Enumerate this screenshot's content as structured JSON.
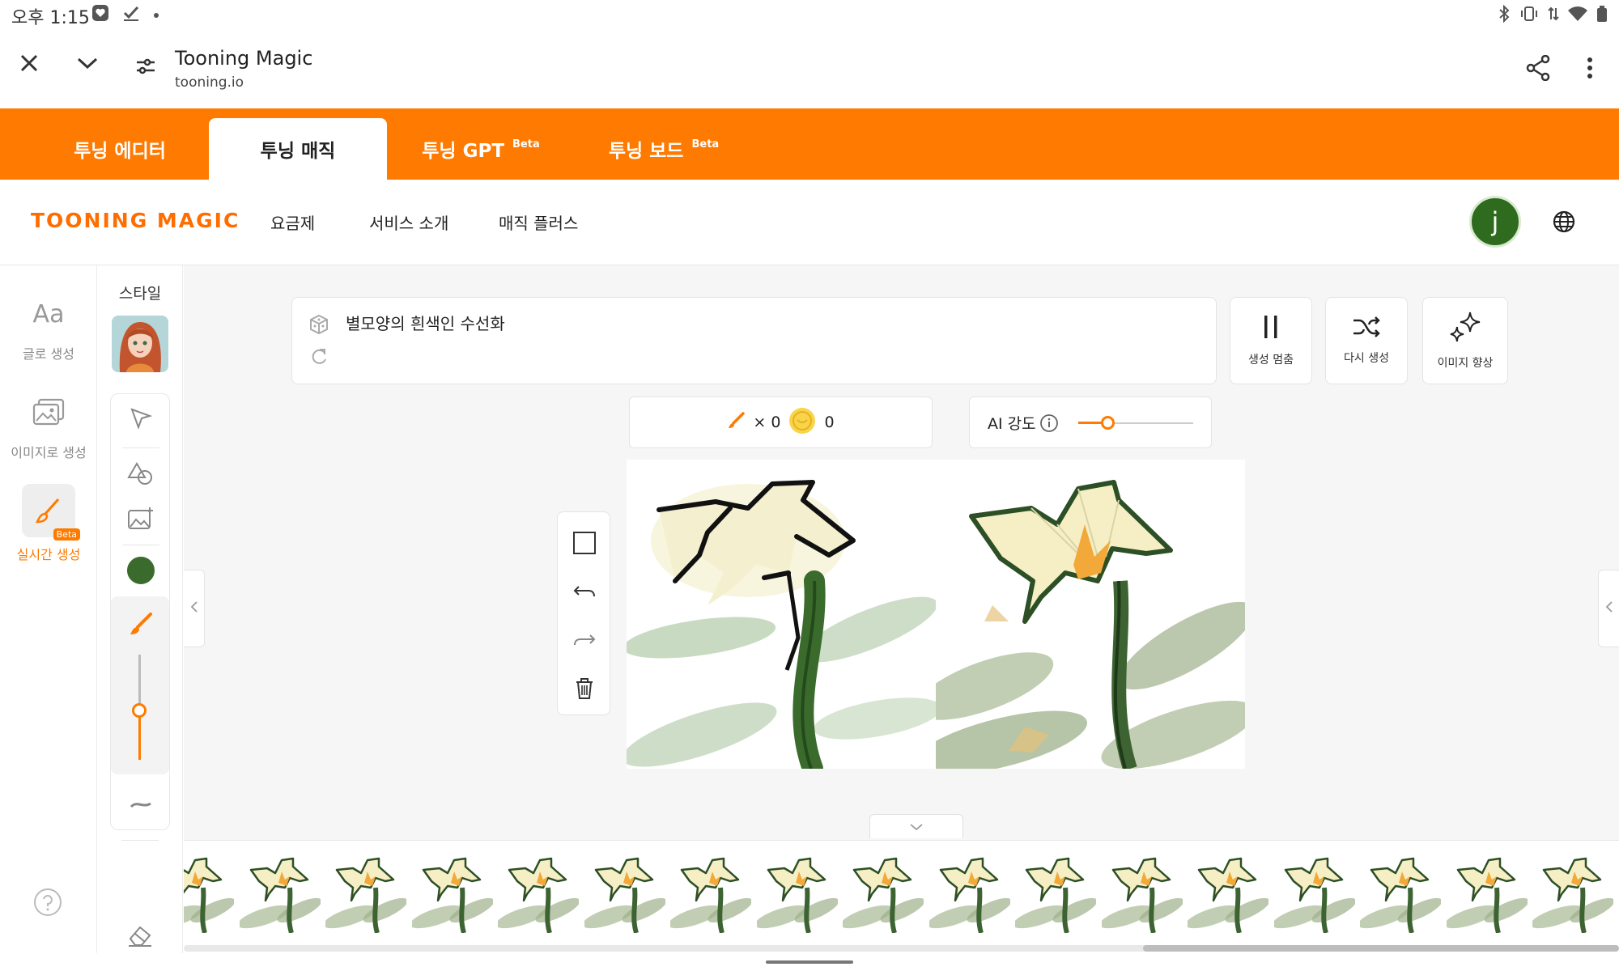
{
  "status_bar": {
    "time": "오후 1:15",
    "left_icons": [
      "shield-heart-icon",
      "check-icon",
      "dot-icon"
    ],
    "right_icons": [
      "bluetooth-icon",
      "vibrate-icon",
      "data-arrows-icon",
      "wifi-icon",
      "battery-icon"
    ]
  },
  "browser": {
    "title": "Tooning Magic",
    "url": "tooning.io",
    "icons": [
      "close-icon",
      "chevron-down-icon",
      "site-settings-icon",
      "share-icon",
      "more-vert-icon"
    ]
  },
  "product_tabs": [
    {
      "label": "투닝 에디터",
      "beta": "",
      "active": false
    },
    {
      "label": "투닝 매직",
      "beta": "",
      "active": true
    },
    {
      "label": "투닝 GPT",
      "beta": "Beta",
      "active": false
    },
    {
      "label": "투닝 보드",
      "beta": "Beta",
      "active": false
    }
  ],
  "nav": {
    "logo": "TOONING MAGIC",
    "links": [
      "요금제",
      "서비스 소개",
      "매직 플러스"
    ],
    "avatar_letter": "j",
    "avatar_color": "#2e6b1f"
  },
  "sidebar": {
    "items": [
      {
        "label": "글로 생성",
        "icon": "text-aa-icon",
        "active": false
      },
      {
        "label": "이미지로 생성",
        "icon": "image-gallery-icon",
        "active": false
      },
      {
        "label": "실시간 생성",
        "icon": "brush-icon",
        "active": true,
        "badge": "Beta"
      }
    ],
    "help_icon": "help-icon"
  },
  "tools": {
    "style_label": "스타일",
    "items": [
      "select-arrow-icon",
      "shapes-icon",
      "add-image-icon",
      "color-swatch",
      "brush-icon",
      "brush-size-slider",
      "smooth-line-icon",
      "eraser-icon"
    ],
    "current_color": "#3a6b2c",
    "brush_size_fraction": 0.35
  },
  "prompt": {
    "text": "별모양의 흰색인 수선화",
    "icons": [
      "dice-icon",
      "refresh-icon"
    ]
  },
  "actions": [
    {
      "label": "생성 멈춤",
      "icon": "pause-icon"
    },
    {
      "label": "다시 생성",
      "icon": "shuffle-icon"
    },
    {
      "label": "이미지 향상",
      "icon": "sparkle-icon"
    }
  ],
  "counter": {
    "brush_count": "× 0",
    "coin_count": "0"
  },
  "ai_strength": {
    "label": "AI 강도",
    "value_fraction": 0.25
  },
  "canvas_tools": [
    "frame-icon",
    "undo-icon",
    "redo-icon",
    "trash-icon"
  ],
  "colors": {
    "accent": "#ff7a00",
    "stem_green": "#3a6b2c",
    "petal": "#f4f0cf"
  },
  "history_thumbnails": 17
}
